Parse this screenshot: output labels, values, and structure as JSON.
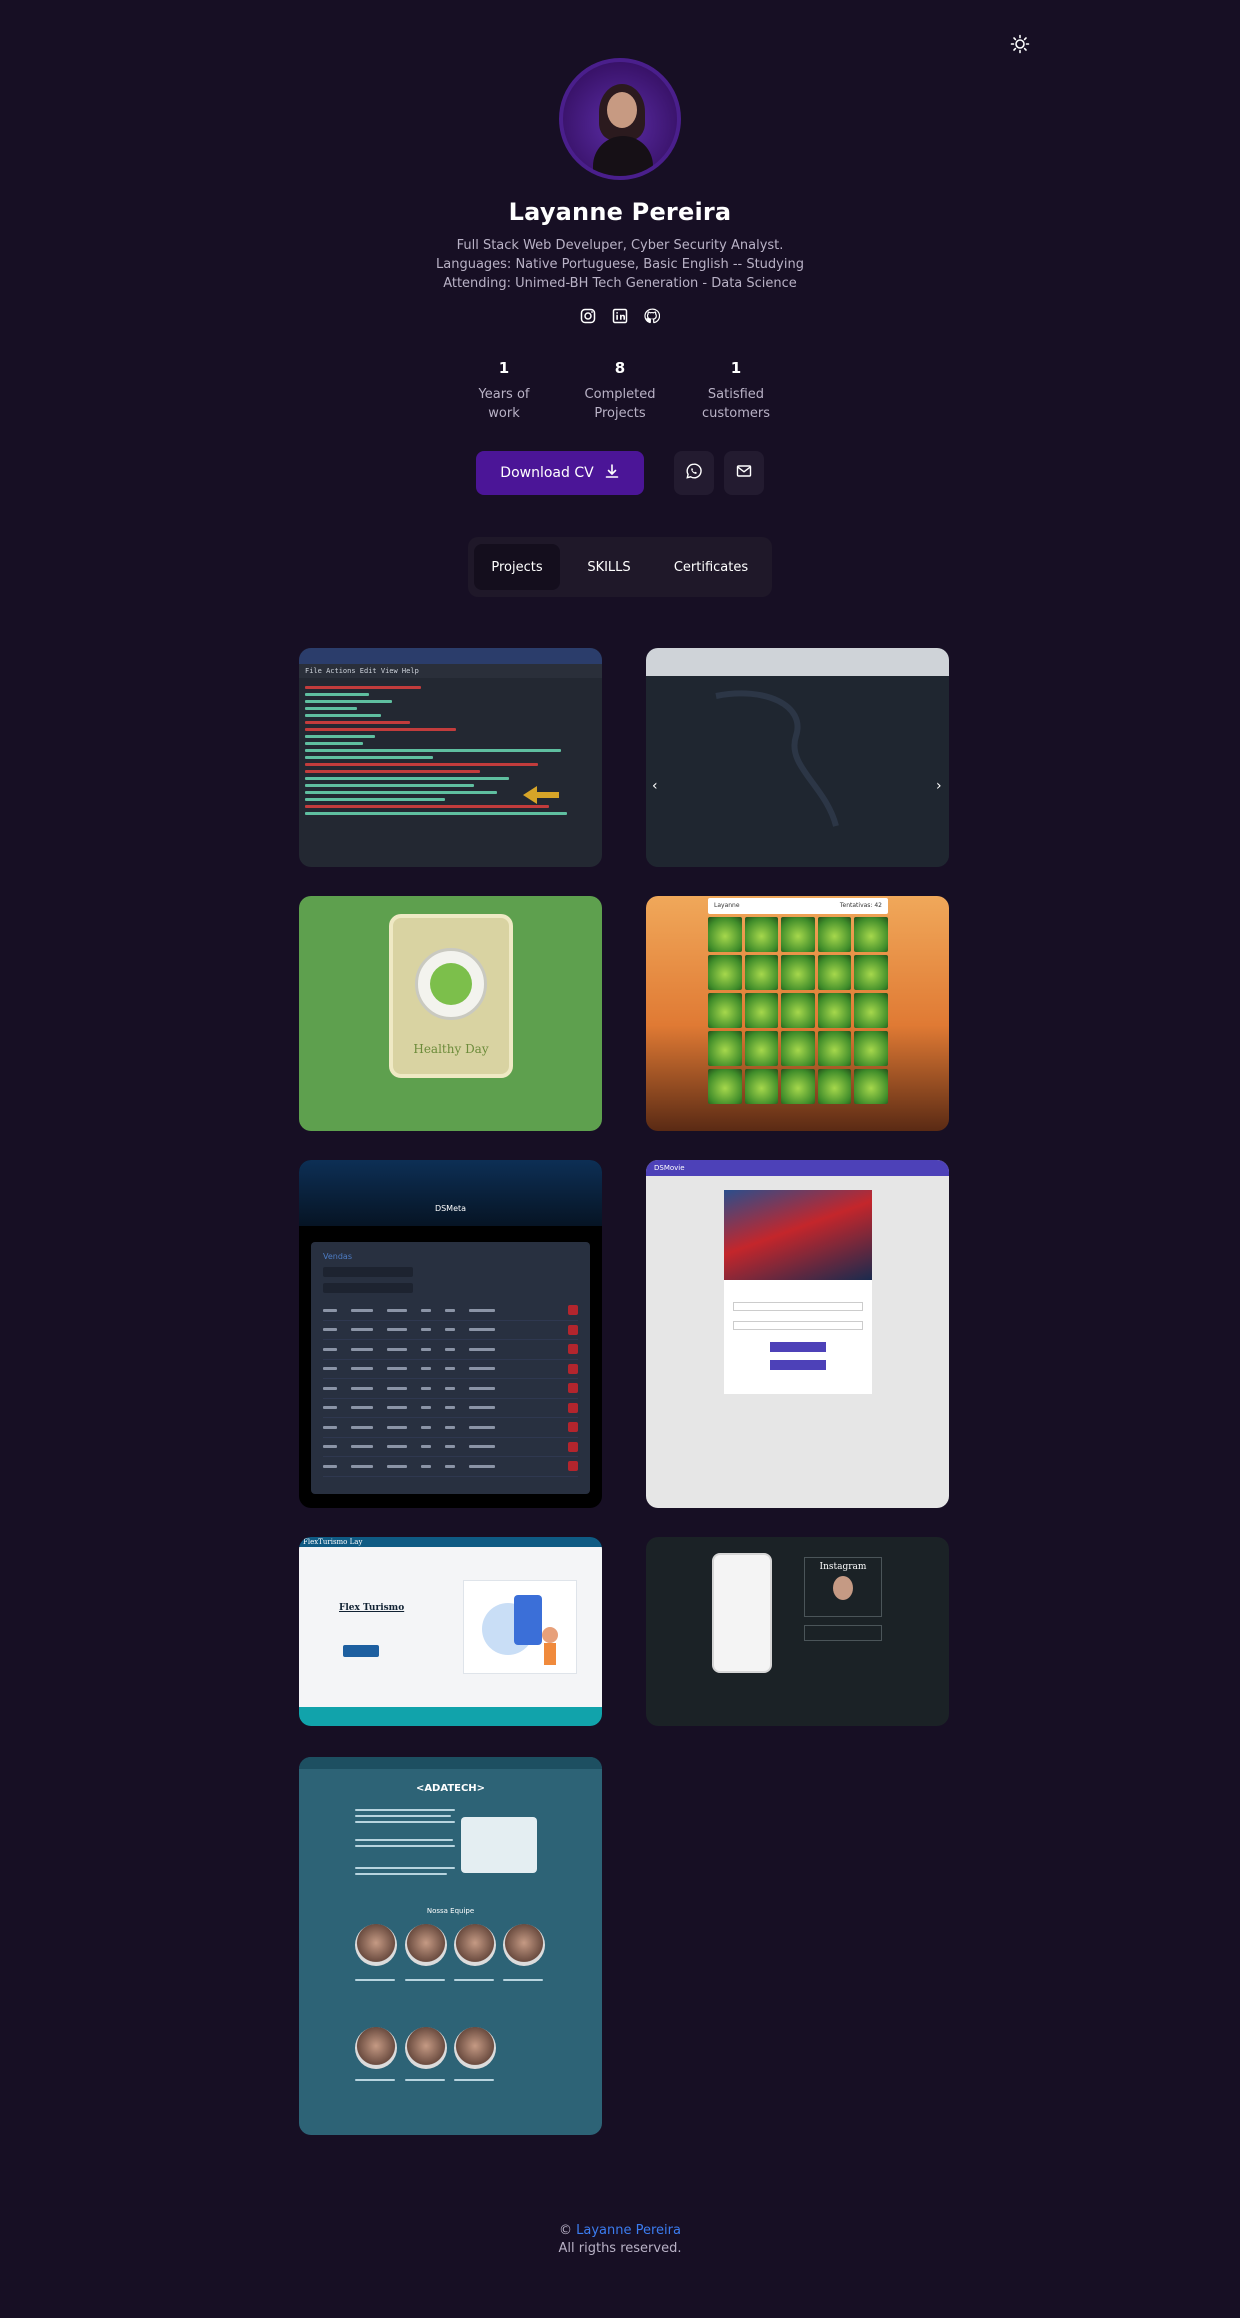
{
  "theme_toggle": {
    "icon": "sun-icon"
  },
  "profile": {
    "name": "Layanne Pereira",
    "bio": [
      "Full Stack Web Develuper, Cyber Security Analyst.",
      "Languages: Native Portuguese, Basic English -- Studying",
      "Attending: Unimed-BH Tech Generation - Data Science"
    ]
  },
  "socials": [
    {
      "icon": "instagram-icon"
    },
    {
      "icon": "linkedin-icon"
    },
    {
      "icon": "github-icon"
    }
  ],
  "stats": [
    {
      "value": "1",
      "label_line1": "Years of",
      "label_line2": "work"
    },
    {
      "value": "8",
      "label_line1": "Completed",
      "label_line2": "Projects"
    },
    {
      "value": "1",
      "label_line1": "Satisfied",
      "label_line2": "customers"
    }
  ],
  "actions": {
    "download_label": "Download CV",
    "download_icon": "download-icon",
    "whatsapp_icon": "whatsapp-icon",
    "email_icon": "mail-icon"
  },
  "tabs": [
    {
      "label": "Projects",
      "active": true
    },
    {
      "label": "SKILLS",
      "active": false
    },
    {
      "label": "Certificates",
      "active": false
    }
  ],
  "projects": {
    "terminal_menu": "File  Actions  Edit  View  Help",
    "healthy_label": "Healthy Day",
    "game_player": "Layanne",
    "game_score": "Tentativas: 42",
    "dsmeta_title": "DSMeta",
    "dsmeta_panel": "Vendas",
    "dsmovie_title": "DSMovie",
    "flex_header": "FlexTurismo Lay",
    "flex_title": "Flex Turismo",
    "instagram_title": "Instagram",
    "adatech_logo": "<ADATECH>",
    "adatech_team": "Nossa Equipe"
  },
  "footer": {
    "copyright_symbol": "©",
    "author": "Layanne Pereira",
    "rights": "All rigths reserved."
  },
  "colors": {
    "background": "#170f24",
    "accent": "#4b1597",
    "link": "#3b7cf0"
  }
}
